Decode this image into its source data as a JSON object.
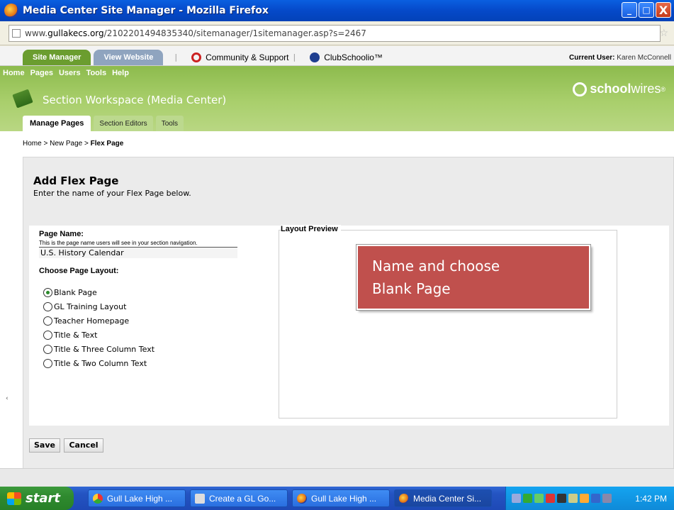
{
  "window": {
    "title": "Media Center Site Manager - Mozilla Firefox",
    "buttons": {
      "minimize": "_",
      "maximize": "□",
      "close": "X"
    }
  },
  "address_bar": {
    "url_prefix": "www.",
    "url_domain": "gullakecs.org",
    "url_path": "/2102201494835340/sitemanager/1sitemanager.asp?s=2467"
  },
  "sw_topbar": {
    "site_manager": "Site Manager",
    "view_website": "View Website",
    "community": "Community & Support",
    "clubschoolio": "ClubSchoolio™",
    "current_user_label": "Current User:",
    "current_user_name": "Karen McConnell"
  },
  "menu": [
    "Home",
    "Pages",
    "Users",
    "Tools",
    "Help"
  ],
  "workspace": {
    "title": "Section Workspace (Media Center)",
    "logo_bold": "school",
    "logo_rest": "wires",
    "logo_mark": "®",
    "tabs": [
      "Manage Pages",
      "Section Editors",
      "Tools"
    ]
  },
  "breadcrumb": {
    "part1": "Home",
    "sep": " > ",
    "part2": "New Page",
    "current": "Flex Page"
  },
  "form": {
    "title": "Add Flex Page",
    "subtitle": "Enter the name of your Flex Page below.",
    "page_name_label": "Page Name:",
    "page_name_help": "This is the page name users will see in your section navigation.",
    "page_name_value": "U.S. History Calendar",
    "layout_label": "Choose Page Layout:",
    "layouts": [
      {
        "label": "Blank Page",
        "checked": true
      },
      {
        "label": "GL Training Layout",
        "checked": false
      },
      {
        "label": "Teacher Homepage",
        "checked": false
      },
      {
        "label": "Title & Text",
        "checked": false
      },
      {
        "label": "Title & Three Column Text",
        "checked": false
      },
      {
        "label": "Title & Two Column Text",
        "checked": false
      }
    ],
    "layout_preview_label": "Layout Preview",
    "save": "Save",
    "cancel": "Cancel"
  },
  "callout": {
    "line1": "Name and choose",
    "line2": "Blank Page",
    "color": "#c0504d"
  },
  "taskbar": {
    "start": "start",
    "tasks": [
      {
        "label": "Gull Lake High ...",
        "icon": "chrome-icon",
        "active": false
      },
      {
        "label": "Create a GL Go...",
        "icon": "doc-icon",
        "active": false
      },
      {
        "label": "Gull Lake High ...",
        "icon": "firefox-icon",
        "active": false
      },
      {
        "label": "Media Center Si...",
        "icon": "firefox-icon",
        "active": true
      }
    ],
    "clock": "1:42 PM"
  }
}
